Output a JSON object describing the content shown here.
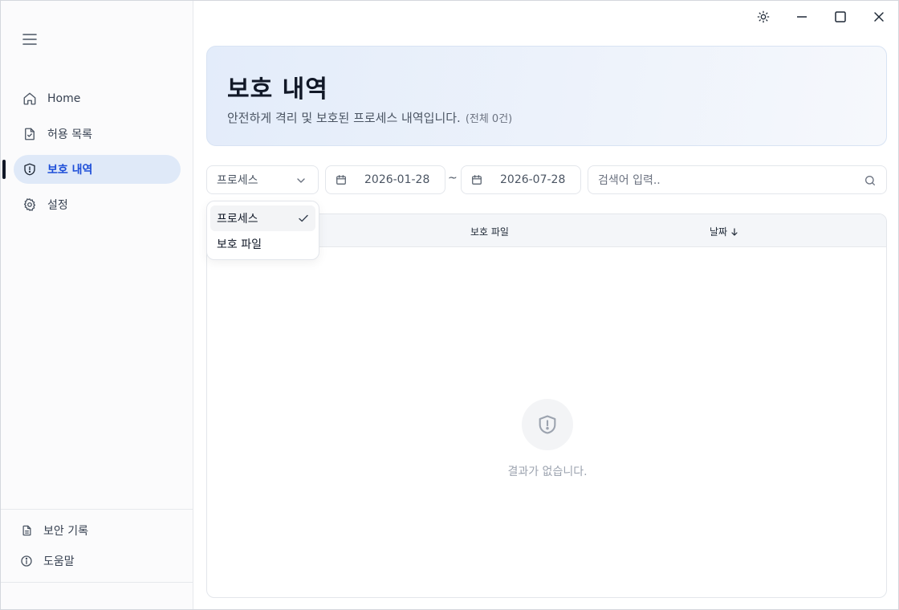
{
  "sidebar": {
    "nav": [
      {
        "label": "Home",
        "icon": "home-icon"
      },
      {
        "label": "허용 목록",
        "icon": "file-check-icon"
      },
      {
        "label": "보호 내역",
        "icon": "shield-alert-icon",
        "active": true
      },
      {
        "label": "설정",
        "icon": "gear-icon"
      }
    ],
    "bottom": [
      {
        "label": "보안 기록",
        "icon": "document-icon"
      },
      {
        "label": "도움말",
        "icon": "info-icon"
      }
    ]
  },
  "hero": {
    "title": "보호 내역",
    "subtitle": "안전하게 격리 및 보호된 프로세스 내역입니다.",
    "count": "(전체 0건)"
  },
  "filters": {
    "type_selected": "프로세스",
    "date_from": "2026-01-28",
    "date_separator": "~",
    "date_to": "2026-07-28",
    "search_placeholder": "검색어 입력.."
  },
  "dropdown": {
    "options": [
      {
        "label": "프로세스",
        "selected": true
      },
      {
        "label": "보호 파일",
        "selected": false
      }
    ]
  },
  "table": {
    "columns": [
      "보호 파일",
      "날짜"
    ],
    "sort_indicator": "↓",
    "empty_message": "결과가 없습니다."
  },
  "colors": {
    "accent": "#1d4ed8",
    "active_bg": "#dfe9f8",
    "hero_bg": "#e3ecfa"
  }
}
